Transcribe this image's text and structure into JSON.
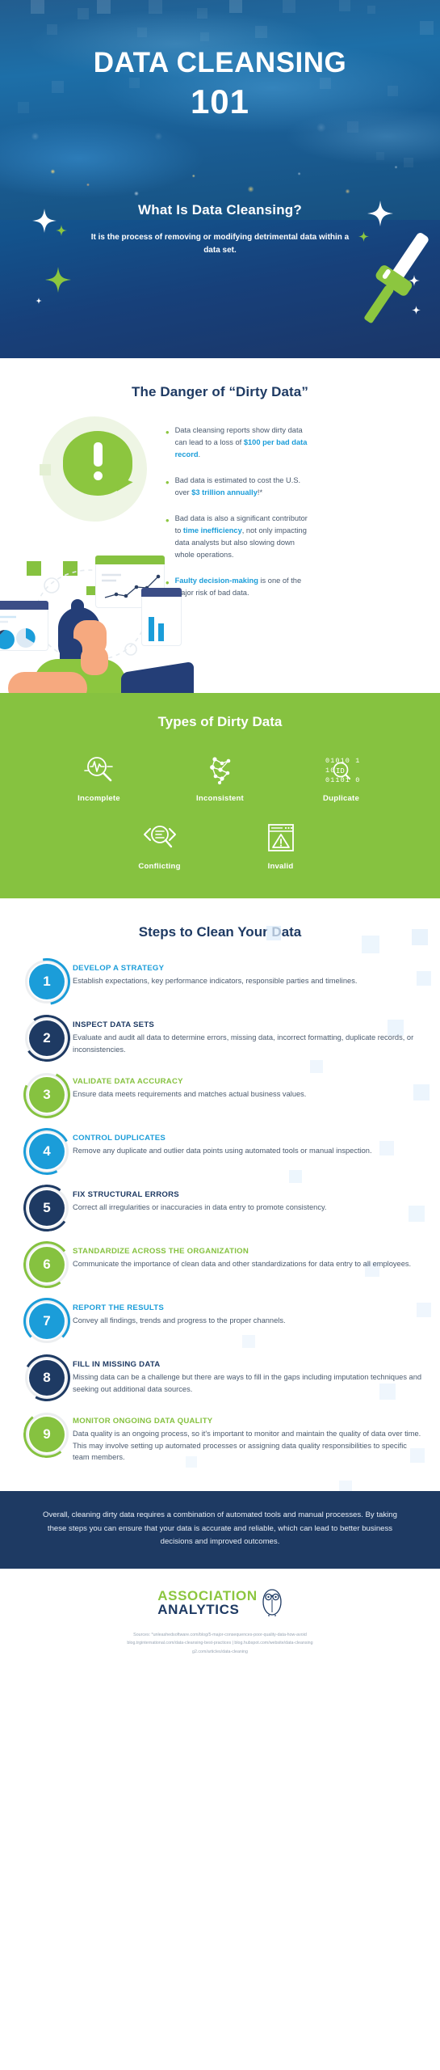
{
  "hero": {
    "title": "DATA CLEANSING",
    "number": "101",
    "question": "What Is Data Cleansing?",
    "description": "It is the process of removing or modifying detrimental data within a data set.",
    "squeegee_icon": "squeegee-icon",
    "sparkle_icon": "sparkle-icon"
  },
  "danger": {
    "title": "The Danger of “Dirty Data”",
    "illustration_icon": "person-thinking-with-alert-bubble-illustration",
    "bullets": [
      {
        "id": "bullet-loss-per-record",
        "pre": "Data cleansing reports show dirty data can lead to a loss of ",
        "highlight": "$100 per bad data record",
        "post": "."
      },
      {
        "id": "bullet-us-cost",
        "pre": "Bad data is estimated to cost the U.S. over ",
        "highlight": "$3 trillion annually",
        "post": "!*"
      },
      {
        "id": "bullet-time-inefficiency",
        "pre": "Bad data is also a significant contributor to ",
        "highlight": "time inefficiency",
        "post": ", not only impacting data analysts but also slowing down whole operations."
      },
      {
        "id": "bullet-faulty-decisions",
        "pre": "",
        "highlight": "Faulty decision-making",
        "post": " is one of the major risk of bad data."
      }
    ]
  },
  "types": {
    "title": "Types of Dirty Data",
    "items": [
      {
        "label": "Incomplete",
        "icon": "magnifier-heartbeat-icon"
      },
      {
        "label": "Inconsistent",
        "icon": "network-nodes-icon"
      },
      {
        "label": "Duplicate",
        "icon": "binary-magnifier-icon"
      },
      {
        "label": "Conflicting",
        "icon": "magnifier-arrows-icon"
      },
      {
        "label": "Invalid",
        "icon": "browser-warning-icon"
      }
    ]
  },
  "steps": {
    "title": "Steps to Clean Your Data",
    "items": [
      {
        "number": "1",
        "heading": "DEVELOP A STRATEGY",
        "body": "Establish expectations, key performance indicators, responsible parties and timelines.",
        "color": "#1b9dd9"
      },
      {
        "number": "2",
        "heading": "INSPECT DATA SETS",
        "body": "Evaluate and audit all data to determine errors, missing data, incorrect formatting, duplicate records, or inconsistencies.",
        "color": "#1e3a63"
      },
      {
        "number": "3",
        "heading": "VALIDATE DATA ACCURACY",
        "body": "Ensure data meets requirements and matches actual business values.",
        "color": "#86c240"
      },
      {
        "number": "4",
        "heading": "CONTROL DUPLICATES",
        "body": "Remove any duplicate and outlier data points using automated tools or manual inspection.",
        "color": "#1b9dd9"
      },
      {
        "number": "5",
        "heading": "FIX STRUCTURAL ERRORS",
        "body": "Correct all irregularities or inaccuracies in data entry to promote consistency.",
        "color": "#1e3a63"
      },
      {
        "number": "6",
        "heading": "STANDARDIZE ACROSS THE ORGANIZATION",
        "body": "Communicate the importance of clean data and other standardizations for data entry to all employees.",
        "color": "#86c240"
      },
      {
        "number": "7",
        "heading": "REPORT THE RESULTS",
        "body": "Convey all findings, trends and progress to the proper channels.",
        "color": "#1b9dd9"
      },
      {
        "number": "8",
        "heading": "FILL IN MISSING DATA",
        "body": "Missing data can be a challenge but there are ways to fill in the gaps including imputation techniques and seeking out additional data sources.",
        "color": "#1e3a63"
      },
      {
        "number": "9",
        "heading": "MONITOR ONGOING DATA QUALITY",
        "body": "Data quality is an ongoing process, so it's important to monitor and maintain the quality of data over time. This may involve setting up automated processes or assigning data quality responsibilities to specific team members.",
        "color": "#86c240"
      }
    ]
  },
  "conclusion": {
    "text": "Overall, cleaning dirty data requires a combination of automated tools and manual processes. By taking these steps you can ensure that your data is accurate and reliable, which can lead to better business decisions and improved outcomes."
  },
  "footer": {
    "logo_line1": "ASSOCIATION",
    "logo_line2": "ANALYTICS",
    "logo_icon": "owl-icon",
    "sources_line1": "Sources: *unleashedsoftware.com/blog/5-major-consequences-poor-quality-data-how-avoid",
    "sources_line2": "blog.trginternational.com/data-cleansing-best-practices | blog.hubspot.com/website/data-cleansing",
    "sources_line3": "g2.com/articles/data-cleaning"
  },
  "colors": {
    "navy": "#1e3a63",
    "green": "#86c240",
    "blue": "#1b9dd9",
    "body_text": "#4a5a6e"
  }
}
